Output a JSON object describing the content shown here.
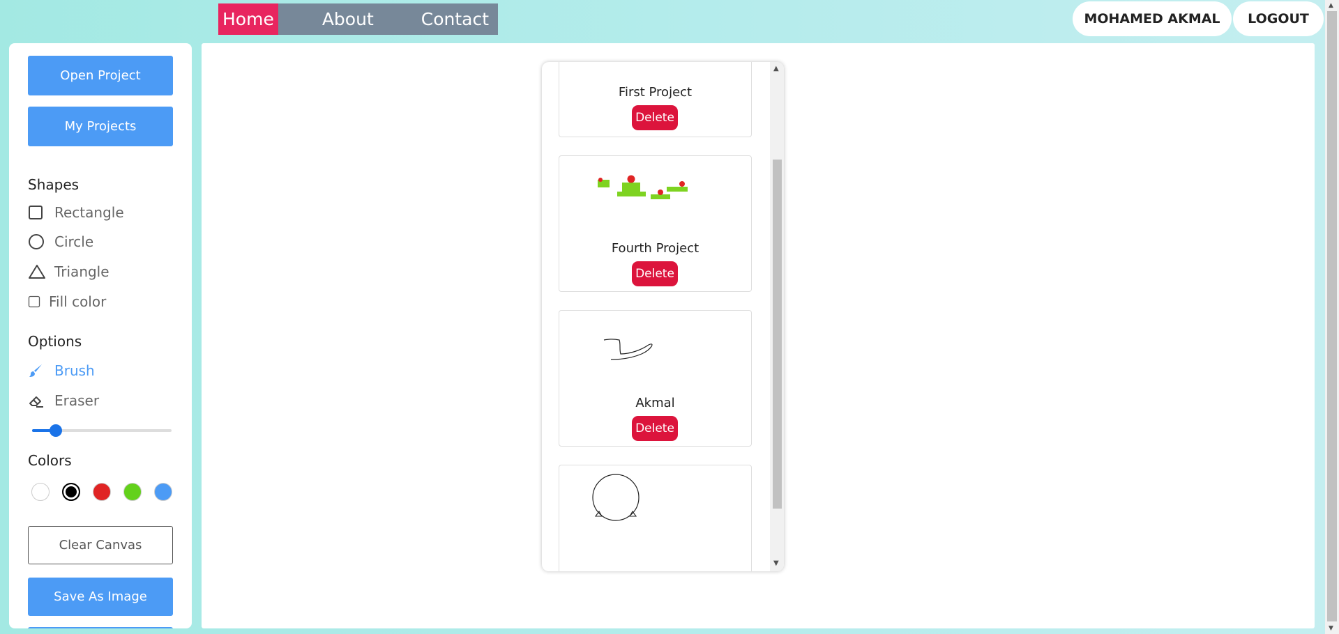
{
  "nav": {
    "items": [
      {
        "label": "Home",
        "active": true
      },
      {
        "label": "About",
        "active": false
      },
      {
        "label": "Contact",
        "active": false
      }
    ]
  },
  "user": {
    "name": "MOHAMED AKMAL",
    "logout_label": "LOGOUT"
  },
  "sidebar": {
    "open_project_label": "Open Project",
    "my_projects_label": "My Projects",
    "shapes_title": "Shapes",
    "shapes": [
      {
        "label": "Rectangle",
        "icon": "square-outline-icon"
      },
      {
        "label": "Circle",
        "icon": "circle-outline-icon"
      },
      {
        "label": "Triangle",
        "icon": "triangle-outline-icon"
      }
    ],
    "fill_color_label": "Fill color",
    "fill_color_checked": false,
    "options_title": "Options",
    "options": [
      {
        "label": "Brush",
        "icon": "brush-icon",
        "active": true
      },
      {
        "label": "Eraser",
        "icon": "eraser-icon",
        "active": false
      }
    ],
    "brush_size_fraction": 0.17,
    "colors_title": "Colors",
    "colors": [
      "#ffffff",
      "#000000",
      "#e02424",
      "#63d11b",
      "#4c9bf5"
    ],
    "selected_color": "#000000",
    "clear_canvas_label": "Clear Canvas",
    "save_image_label": "Save As Image"
  },
  "projects": [
    {
      "name": "First Project",
      "delete_label": "Delete"
    },
    {
      "name": "Fourth Project",
      "delete_label": "Delete"
    },
    {
      "name": "Akmal",
      "delete_label": "Delete"
    },
    {
      "name": "",
      "delete_label": ""
    }
  ],
  "colors": {
    "nav_bg": "#778899",
    "nav_active": "#e8255f",
    "primary_button": "#4c9bf5",
    "delete_button": "#dc143c",
    "background_gradient_start": "#a3e9e3"
  }
}
